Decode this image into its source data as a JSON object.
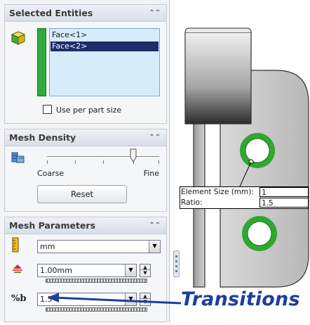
{
  "selected_entities": {
    "title": "Selected Entities",
    "items": [
      {
        "label": "Face<1>",
        "selected": false
      },
      {
        "label": "Face<2>",
        "selected": true
      }
    ],
    "per_part_checkbox": {
      "label": "Use per part size",
      "checked": false
    }
  },
  "mesh_density": {
    "title": "Mesh Density",
    "coarse_label": "Coarse",
    "fine_label": "Fine",
    "reset_label": "Reset"
  },
  "mesh_parameters": {
    "title": "Mesh Parameters",
    "unit_value": "mm",
    "element_size_value": "1.00mm",
    "ratio_value": "1.5",
    "ratio_icon": "%b"
  },
  "graphics": {
    "callout": {
      "size_label": "Element Size (mm):",
      "size_value": "1",
      "ratio_label": "Ratio:",
      "ratio_value": "1.5"
    },
    "annotation": "Transitions"
  },
  "colors": {
    "accent_green": "#2eaa3a",
    "selection_blue": "#1e2c6a",
    "annotation_blue": "#1b3f9e"
  }
}
